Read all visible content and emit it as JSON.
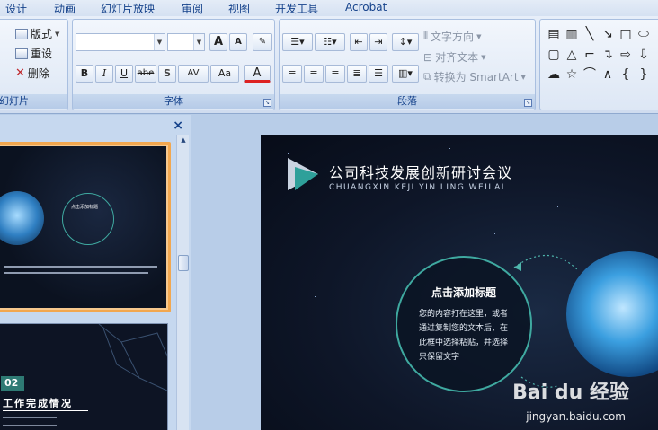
{
  "tabs": [
    "设计",
    "动画",
    "幻灯片放映",
    "审阅",
    "视图",
    "开发工具",
    "Acrobat"
  ],
  "slides_group": {
    "label": "幻灯片",
    "layout": "版式",
    "reset": "重设",
    "delete": "删除"
  },
  "font_group": {
    "label": "字体",
    "grow": "A",
    "shrink": "A",
    "clear": "A",
    "bold": "B",
    "italic": "I",
    "underline": "U",
    "strike": "abe",
    "shadow": "S",
    "spacing": "AV",
    "case": "Aa",
    "color": "A"
  },
  "paragraph_group": {
    "label": "段落",
    "text_direction": "文字方向",
    "align_text": "对齐文本",
    "smartart": "转换为 SmartArt"
  },
  "slide_panel": {
    "close": "×",
    "thumb1_heading": "点击添加标题",
    "thumb2_number": "02",
    "thumb2_title": "工作完成情况"
  },
  "slide": {
    "title": "公司科技发展创新研讨会议",
    "subtitle": "CHUANGXIN KEJI YIN LING WEILAI",
    "circle_title": "点击添加标题",
    "circle_body": "您的内容打在这里，或者通过复制您的文本后，在此框中选择粘贴，并选择只保留文字"
  },
  "watermark": {
    "brand": "Bai du 经验",
    "url": "jingyan.baidu.com"
  },
  "colors": {
    "accent": "#f2a74f",
    "ribbon_text": "#15428b",
    "circle_stroke": "#3fa9a0",
    "logo_teal": "#2ea09a"
  }
}
